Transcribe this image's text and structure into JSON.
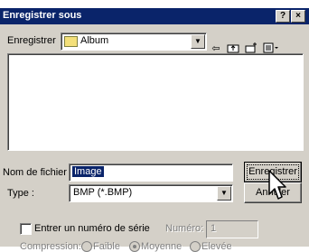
{
  "window": {
    "title": "Enregistrer sous",
    "help_label": "?",
    "close_label": "×"
  },
  "location": {
    "label": "Enregistrer",
    "folder": "Album"
  },
  "file": {
    "name_label": "Nom de fichier :",
    "name_value": "Image",
    "type_label": "Type :",
    "type_value": "BMP (*.BMP)"
  },
  "buttons": {
    "save": "Enregistrer",
    "cancel": "Annuler"
  },
  "options": {
    "serial_label": "Entrer un numéro de série",
    "number_label": "Numéro:",
    "number_value": "1",
    "compression_label": "Compression:",
    "compression_options": [
      "Faible",
      "Moyenne",
      "Elevée"
    ],
    "compression_selected": "Moyenne"
  },
  "icons": [
    "folder-icon",
    "dropdown-arrow-icon",
    "back-arrow-icon",
    "up-folder-icon",
    "new-folder-icon",
    "view-menu-icon",
    "mouse-cursor-icon"
  ]
}
